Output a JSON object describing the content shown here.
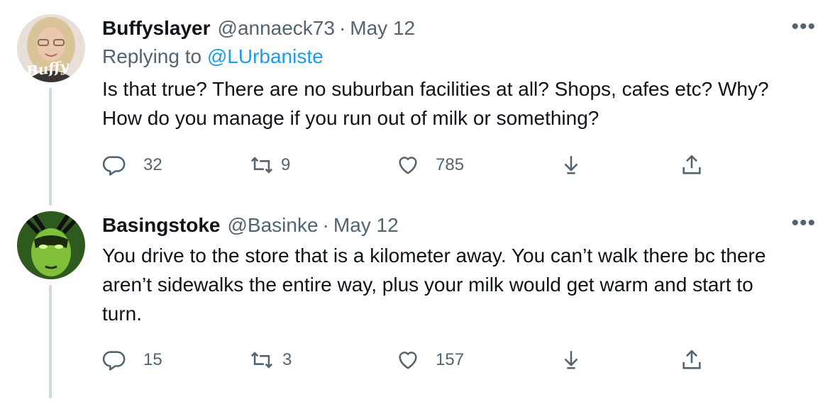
{
  "tweets": [
    {
      "name": "Buffyslayer",
      "handle": "@annaeck73",
      "separator": "·",
      "date": "May 12",
      "replying_prefix": "Replying to",
      "replying_mention": "@LUrbaniste",
      "avatar_text": "Buffy",
      "text_line1": "Is that true? There are no suburban facilities at all? Shops, cafes etc? Why?",
      "text_line2": "How do you manage if you run out of milk or something?",
      "text_line3": "",
      "replies": "32",
      "retweets": "9",
      "likes": "785",
      "more_label": "•••"
    },
    {
      "name": "Basingstoke",
      "handle": "@Basinke",
      "separator": "·",
      "date": "May 12",
      "text_line1": "You drive to the store that is a kilometer away. You can’t walk there bc there",
      "text_line2": "aren’t sidewalks the entire way, plus your milk would get warm and start to",
      "text_line3": "turn.",
      "replies": "15",
      "retweets": "3",
      "likes": "157",
      "more_label": "•••"
    }
  ],
  "icons": {
    "reply": "reply-icon",
    "retweet": "retweet-icon",
    "like": "heart-icon",
    "download": "download-icon",
    "share": "share-icon"
  },
  "colors": {
    "text": "#0f1419",
    "secondary": "#536471",
    "link": "#1d9bf0",
    "thread_line": "#cfd9de"
  }
}
